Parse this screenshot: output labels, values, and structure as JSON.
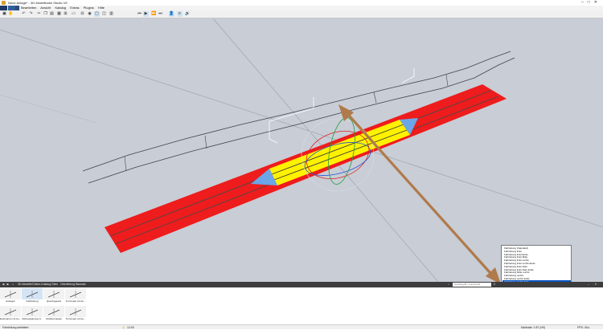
{
  "window": {
    "title": "Neue Anlage* - 3D-Modellbahn Studio V5",
    "controls": [
      "–",
      "□",
      "✕"
    ]
  },
  "menubar": {
    "items": [
      "Bearbeiten",
      "Ansicht",
      "Katalog",
      "Extras",
      "Plugins",
      "Hilfe"
    ]
  },
  "toolbar": {
    "buttons": [
      {
        "icon": "save-icon",
        "glyph": "▣",
        "active": false
      },
      {
        "icon": "hand-icon",
        "glyph": "✋",
        "active": false
      },
      {
        "icon": "undo-icon",
        "glyph": "↶",
        "active": false
      },
      {
        "icon": "redo-icon",
        "glyph": "↷",
        "active": false
      },
      {
        "icon": "cut-icon",
        "glyph": "✂",
        "active": false
      },
      {
        "icon": "copy-icon",
        "glyph": "❐",
        "active": false
      },
      {
        "icon": "paste-icon",
        "glyph": "▤",
        "active": false
      },
      {
        "icon": "grid-icon",
        "glyph": "▦",
        "active": false
      },
      {
        "icon": "snap-icon",
        "glyph": "⊞",
        "active": false
      },
      {
        "icon": "delete-icon",
        "glyph": "▭",
        "active": false
      },
      {
        "icon": "hierarchy-icon",
        "glyph": "⊟",
        "active": false
      },
      {
        "icon": "camera-icon",
        "glyph": "◉",
        "active": false
      },
      {
        "icon": "view-2d-icon",
        "glyph": "▢",
        "active": true
      },
      {
        "icon": "view-3d-icon",
        "glyph": "◫",
        "active": false
      },
      {
        "icon": "layers-icon",
        "glyph": "▥",
        "active": false
      },
      {
        "icon": "skip-back-icon",
        "glyph": "⏮",
        "active": false
      },
      {
        "icon": "play-icon",
        "glyph": "▶",
        "active": true
      },
      {
        "icon": "fast-forward-icon",
        "glyph": "⏩",
        "active": false
      },
      {
        "icon": "skip-forward-icon",
        "glyph": "⏭",
        "active": false
      },
      {
        "icon": "person-icon",
        "glyph": "👤",
        "active": true
      },
      {
        "icon": "speed-icon",
        "glyph": "≡",
        "active": true
      },
      {
        "icon": "sound-icon",
        "glyph": "🔊",
        "active": false
      }
    ]
  },
  "dropdown": {
    "items": [
      "Fahrleitung (Standard)",
      "Fahrleitung links",
      "Fahrleitung links Ende",
      "Fahrleitung links Mitte",
      "Fahrleitung links rechts",
      "Fahrleitung links rechts Ende",
      "Fahrleitung links Start",
      "Fahrleitung links Start Ende",
      "Fahrleitung Mitte rechts",
      "Fahrleitung rechts",
      "Fahrleitung rechts Ende",
      "Fahrleitung rechts links",
      "Fahrleitung rechts links Ende",
      "Fahrleitung rechts Mitte",
      "Fahrleitung Tunnel",
      "Fahrleitung Tunnel rechts"
    ],
    "selected_index": 11,
    "current_value": "Fahrleitung rechts links"
  },
  "panel": {
    "breadcrumb": [
      "3D-Modelle",
      "Online-Katalog",
      "Gleis",
      "Oberleitung Bausatz"
    ],
    "search_placeholder": "Suchbegriff / Content-ID"
  },
  "catalog": {
    "items": [
      {
        "label": "Ausleger",
        "selected": false
      },
      {
        "label": "Fahrleitung",
        "selected": true
      },
      {
        "label": "Quertragwerk",
        "selected": false
      },
      {
        "label": "Turmmast mit Au...",
        "selected": false
      },
      {
        "label": "Endmarnst mit Au...",
        "selected": false
      },
      {
        "label": "Verbauspanung 0...",
        "selected": false
      },
      {
        "label": "Streifenmasten",
        "selected": false
      },
      {
        "label": "Turmmast mit Au...",
        "selected": false
      }
    ]
  },
  "status": {
    "left": "Fahrleitung selektiert",
    "center": "12:00",
    "right_scale": "Maßstab: 1:87 (H0)",
    "right_fps": "FPS: 40 ▸"
  },
  "colors": {
    "viewport_bg": "#c8cdd6",
    "track_red": "#ee1c1c",
    "track_yellow": "#fff200",
    "end_blue": "#6aa6e8",
    "arrow_tan": "#b07a4a"
  }
}
